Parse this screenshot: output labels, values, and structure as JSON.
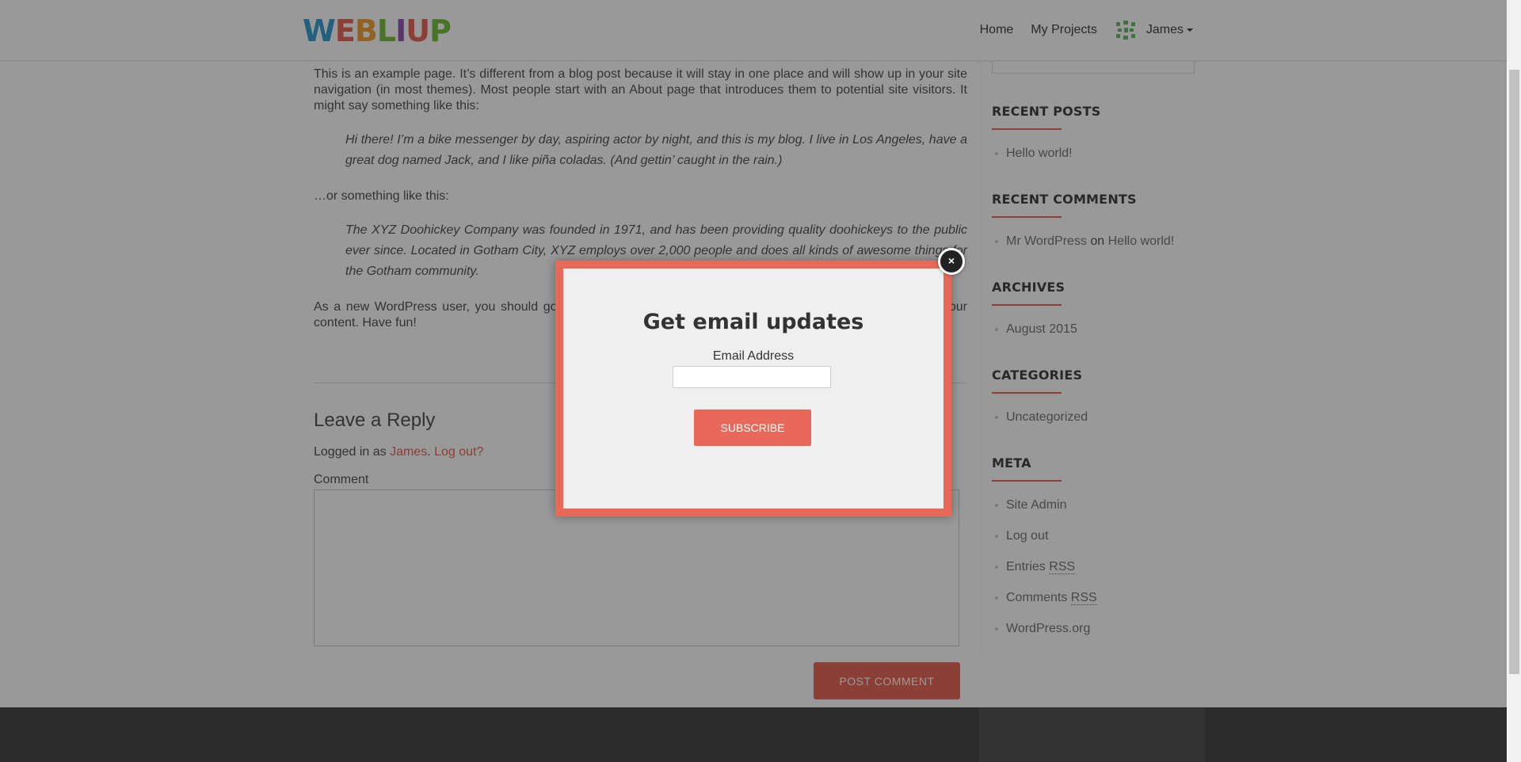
{
  "header": {
    "logo_letters": [
      {
        "ch": "W",
        "color": "#3aa0d5"
      },
      {
        "ch": "E",
        "color": "#e8695a"
      },
      {
        "ch": "B",
        "color": "#f2a33a"
      },
      {
        "ch": "L",
        "color": "#7bc043"
      },
      {
        "ch": "I",
        "color": "#9b59b6"
      },
      {
        "ch": "U",
        "color": "#e8695a"
      },
      {
        "ch": "P",
        "color": "#7bc043"
      }
    ],
    "nav": {
      "home": "Home",
      "projects": "My Projects",
      "user": "James"
    }
  },
  "content": {
    "intro": "This is an example page. It’s different from a blog post because it will stay in one place and will show up in your site navigation (in most themes). Most people start with an About page that introduces them to potential site visitors. It might say something like this:",
    "quote1": "Hi there! I’m a bike messenger by day, aspiring actor by night, and this is my blog. I live in Los Angeles, have a great dog named Jack, and I like piña coladas. (And gettin’ caught in the rain.)",
    "or_text": "…or something like this:",
    "quote2": "The XYZ Doohickey Company was founded in 1971, and has been providing quality doohickeys to the public ever since. Located in Gotham City, XYZ employs over 2,000 people and does all kinds of awesome things for the Gotham community.",
    "outro": "As a new WordPress user, you should go to your dashboard to delete this page and create new pages for your content. Have fun!"
  },
  "reply": {
    "title": "Leave a Reply",
    "logged_prefix": "Logged in as ",
    "user_link": "James",
    "sep": ". ",
    "logout_link": "Log out?",
    "comment_label": "Comment",
    "post_button": "POST COMMENT"
  },
  "sidebar": {
    "recent_posts": {
      "title": "RECENT POSTS",
      "items": [
        "Hello world!"
      ]
    },
    "recent_comments": {
      "title": "RECENT COMMENTS",
      "author": "Mr WordPress",
      "on": " on ",
      "post": "Hello world!"
    },
    "archives": {
      "title": "ARCHIVES",
      "items": [
        "August 2015"
      ]
    },
    "categories": {
      "title": "CATEGORIES",
      "items": [
        "Uncategorized"
      ]
    },
    "meta": {
      "title": "META",
      "site_admin": "Site Admin",
      "log_out": "Log out",
      "entries": "Entries ",
      "comments": "Comments ",
      "rss": "RSS",
      "wordpress": "WordPress.org"
    }
  },
  "modal": {
    "close": "×",
    "title": "Get email updates",
    "email_label": "Email Address",
    "email_value": "",
    "subscribe": "SUBSCRIBE"
  },
  "colors": {
    "accent": "#e8695a",
    "footer": "#4a4a4a"
  }
}
